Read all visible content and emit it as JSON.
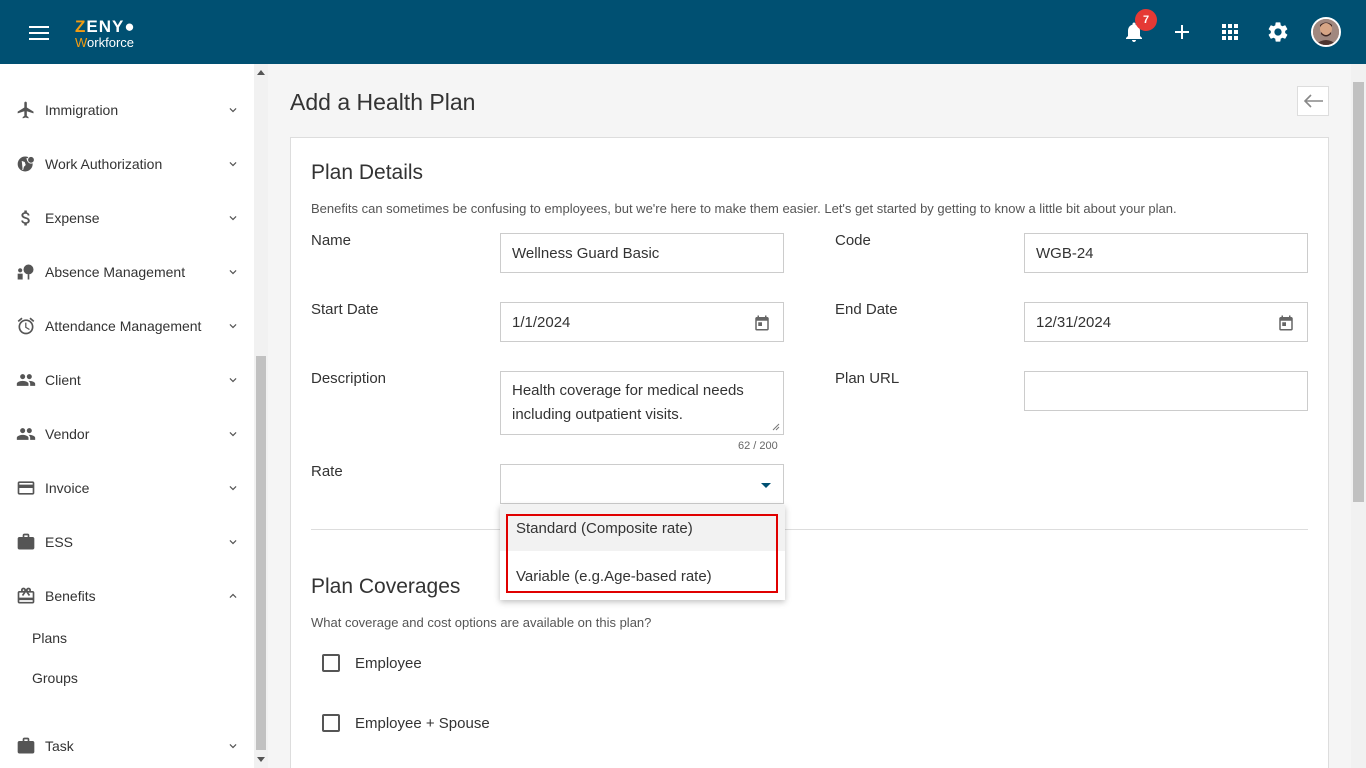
{
  "header": {
    "logo_line1": "ZENY",
    "logo_line2": "Workforce",
    "notification_count": "7",
    "icons": [
      "menu-icon",
      "bell-icon",
      "plus-icon",
      "apps-grid-icon",
      "gear-icon",
      "user-avatar"
    ]
  },
  "sidebar": {
    "items": [
      {
        "label": "Immigration",
        "icon": "airplane-icon",
        "expanded": false
      },
      {
        "label": "Work Authorization",
        "icon": "globe-check-icon",
        "expanded": false
      },
      {
        "label": "Expense",
        "icon": "dollar-icon",
        "expanded": false
      },
      {
        "label": "Absence Management",
        "icon": "absence-icon",
        "expanded": false
      },
      {
        "label": "Attendance Management",
        "icon": "alarm-clock-icon",
        "expanded": false
      },
      {
        "label": "Client",
        "icon": "people-icon",
        "expanded": false
      },
      {
        "label": "Vendor",
        "icon": "people-icon",
        "expanded": false
      },
      {
        "label": "Invoice",
        "icon": "card-icon",
        "expanded": false
      },
      {
        "label": "ESS",
        "icon": "briefcase-icon",
        "expanded": false
      },
      {
        "label": "Benefits",
        "icon": "gift-icon",
        "expanded": true
      },
      {
        "label": "Task",
        "icon": "briefcase-icon",
        "expanded": false
      }
    ],
    "benefits_sub": [
      "Plans",
      "Groups"
    ]
  },
  "page": {
    "title": "Add a Health Plan"
  },
  "plan_details": {
    "title": "Plan Details",
    "subtitle": "Benefits can sometimes be confusing to employees, but we're here to make them easier. Let's get started by getting to know a little bit about your plan.",
    "name_label": "Name",
    "name_value": "Wellness Guard Basic",
    "code_label": "Code",
    "code_value": "WGB-24",
    "start_label": "Start Date",
    "start_value": "1/1/2024",
    "end_label": "End Date",
    "end_value": "12/31/2024",
    "description_label": "Description",
    "description_value": "Health coverage for medical needs including outpatient visits.",
    "description_counter": "62 / 200",
    "plan_url_label": "Plan URL",
    "plan_url_value": "",
    "rate_label": "Rate",
    "rate_value": "",
    "rate_options": [
      "Standard (Composite rate)",
      "Variable (e.g.Age-based rate)"
    ]
  },
  "plan_coverages": {
    "title": "Plan Coverages",
    "subtitle": "What coverage and cost options are available on this plan?",
    "options": [
      {
        "label": "Employee",
        "checked": false
      },
      {
        "label": "Employee + Spouse",
        "checked": false
      }
    ]
  },
  "colors": {
    "topbar": "#005072",
    "accent": "#f39c12",
    "badge": "#e53935",
    "highlight_border": "#e00000"
  }
}
